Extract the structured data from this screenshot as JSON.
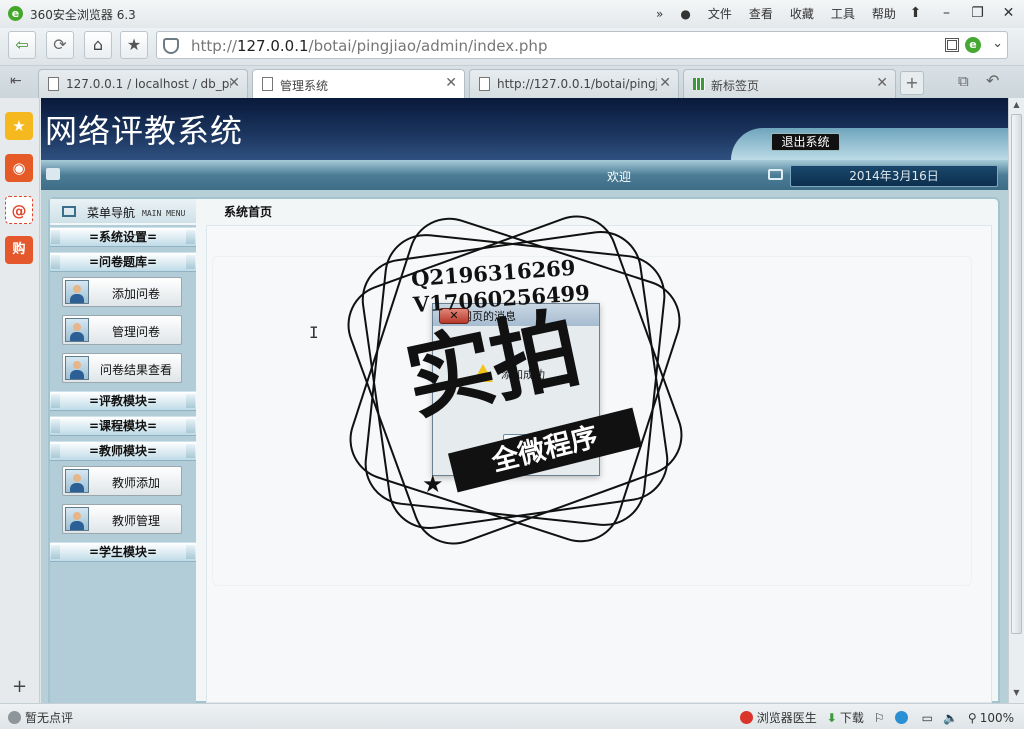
{
  "browser": {
    "app_title": "360安全浏览器 6.3",
    "menus": [
      "文件",
      "查看",
      "收藏",
      "工具",
      "帮助"
    ],
    "url_prefix": "http://",
    "url_host": "127.0.0.1",
    "url_path": "/botai/pingjiao/admin/index.php",
    "tabs": [
      {
        "label": "127.0.0.1 / localhost / db_pi"
      },
      {
        "label": "管理系统"
      },
      {
        "label": "http://127.0.0.1/botai/pingji"
      },
      {
        "label": "新标签页"
      }
    ],
    "sidebar_buttons": [
      "★",
      "◉",
      "@",
      "购"
    ],
    "status": {
      "left": "暂无点评",
      "doctor": "浏览器医生",
      "download": "下载",
      "zoom": "100%"
    }
  },
  "site": {
    "title": "网络评教系统",
    "logout_label": "退出系统",
    "welcome": "欢迎",
    "date": "2014年3月16日",
    "menu_title": "菜单导航",
    "menu_title_en": "MAIN MENU",
    "content_title": "系统首页",
    "sections": [
      {
        "label": "=系统设置=",
        "items": []
      },
      {
        "label": "=问卷题库=",
        "items": [
          "添加问卷",
          "管理问卷",
          "问卷结果查看"
        ]
      },
      {
        "label": "=评教模块=",
        "items": []
      },
      {
        "label": "=课程模块=",
        "items": []
      },
      {
        "label": "=教师模块=",
        "items": [
          "教师添加",
          "教师管理"
        ]
      },
      {
        "label": "=学生模块=",
        "items": []
      }
    ]
  },
  "dialog": {
    "title": "来自网页的消息",
    "message": "添加成功",
    "close_label": "✕"
  },
  "watermark": {
    "line1": "Q2196316269",
    "line2": "V17060256499",
    "main": "实拍",
    "banner": "全微程序"
  },
  "colors": {
    "header_dark": "#09193a",
    "accent_green": "#43a72a",
    "panel_border": "#a3c3ce"
  }
}
